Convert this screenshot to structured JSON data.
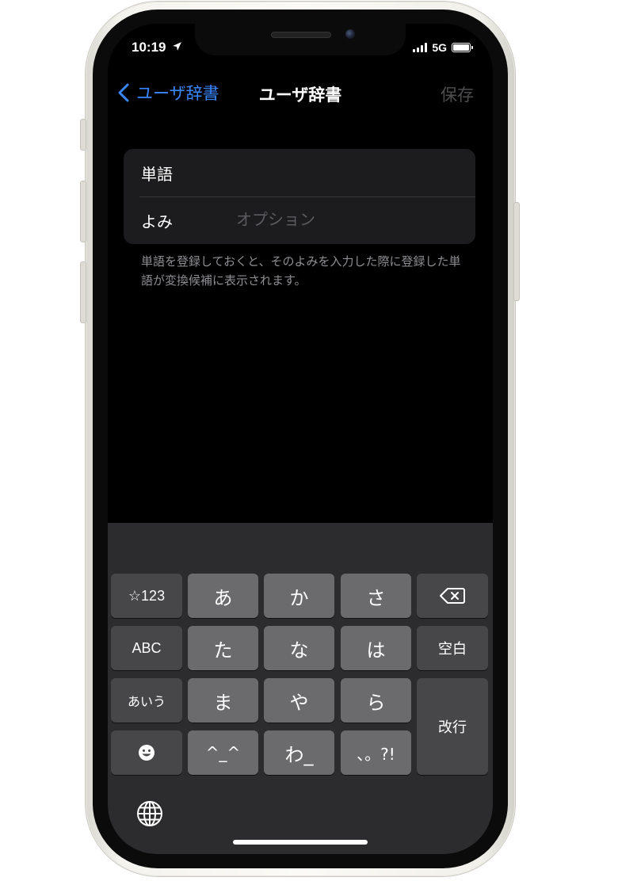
{
  "status_bar": {
    "time": "10:19",
    "network": "5G"
  },
  "nav": {
    "back_label": "ユーザ辞書",
    "title": "ユーザ辞書",
    "save_label": "保存"
  },
  "form": {
    "word_label": "単語",
    "word_value": "",
    "reading_label": "よみ",
    "reading_value": "",
    "reading_placeholder": "オプション"
  },
  "footnote": "単語を登録しておくと、そのよみを入力した際に登録した単語が変換候補に表示されます。",
  "keyboard": {
    "keys": {
      "symbols": "☆123",
      "a": "あ",
      "ka": "か",
      "sa": "さ",
      "abc": "ABC",
      "ta": "た",
      "na": "な",
      "ha": "は",
      "space": "空白",
      "kana_mode": "あいう",
      "ma": "ま",
      "ya": "や",
      "ra": "ら",
      "return": "改行",
      "kaomoji": "^_^",
      "wa": "わ_",
      "punct": "、。?!"
    }
  },
  "colors": {
    "accent": "#3a86ff",
    "background": "#000000",
    "keyboard": "#2c2c2e"
  }
}
